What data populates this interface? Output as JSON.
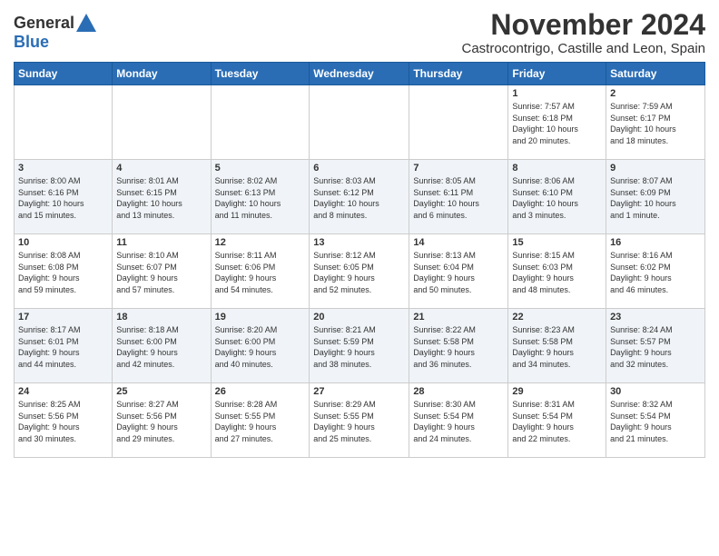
{
  "header": {
    "logo_general": "General",
    "logo_blue": "Blue",
    "month_title": "November 2024",
    "location": "Castrocontrigo, Castille and Leon, Spain"
  },
  "weekdays": [
    "Sunday",
    "Monday",
    "Tuesday",
    "Wednesday",
    "Thursday",
    "Friday",
    "Saturday"
  ],
  "weeks": [
    [
      {
        "day": "",
        "info": ""
      },
      {
        "day": "",
        "info": ""
      },
      {
        "day": "",
        "info": ""
      },
      {
        "day": "",
        "info": ""
      },
      {
        "day": "",
        "info": ""
      },
      {
        "day": "1",
        "info": "Sunrise: 7:57 AM\nSunset: 6:18 PM\nDaylight: 10 hours\nand 20 minutes."
      },
      {
        "day": "2",
        "info": "Sunrise: 7:59 AM\nSunset: 6:17 PM\nDaylight: 10 hours\nand 18 minutes."
      }
    ],
    [
      {
        "day": "3",
        "info": "Sunrise: 8:00 AM\nSunset: 6:16 PM\nDaylight: 10 hours\nand 15 minutes."
      },
      {
        "day": "4",
        "info": "Sunrise: 8:01 AM\nSunset: 6:15 PM\nDaylight: 10 hours\nand 13 minutes."
      },
      {
        "day": "5",
        "info": "Sunrise: 8:02 AM\nSunset: 6:13 PM\nDaylight: 10 hours\nand 11 minutes."
      },
      {
        "day": "6",
        "info": "Sunrise: 8:03 AM\nSunset: 6:12 PM\nDaylight: 10 hours\nand 8 minutes."
      },
      {
        "day": "7",
        "info": "Sunrise: 8:05 AM\nSunset: 6:11 PM\nDaylight: 10 hours\nand 6 minutes."
      },
      {
        "day": "8",
        "info": "Sunrise: 8:06 AM\nSunset: 6:10 PM\nDaylight: 10 hours\nand 3 minutes."
      },
      {
        "day": "9",
        "info": "Sunrise: 8:07 AM\nSunset: 6:09 PM\nDaylight: 10 hours\nand 1 minute."
      }
    ],
    [
      {
        "day": "10",
        "info": "Sunrise: 8:08 AM\nSunset: 6:08 PM\nDaylight: 9 hours\nand 59 minutes."
      },
      {
        "day": "11",
        "info": "Sunrise: 8:10 AM\nSunset: 6:07 PM\nDaylight: 9 hours\nand 57 minutes."
      },
      {
        "day": "12",
        "info": "Sunrise: 8:11 AM\nSunset: 6:06 PM\nDaylight: 9 hours\nand 54 minutes."
      },
      {
        "day": "13",
        "info": "Sunrise: 8:12 AM\nSunset: 6:05 PM\nDaylight: 9 hours\nand 52 minutes."
      },
      {
        "day": "14",
        "info": "Sunrise: 8:13 AM\nSunset: 6:04 PM\nDaylight: 9 hours\nand 50 minutes."
      },
      {
        "day": "15",
        "info": "Sunrise: 8:15 AM\nSunset: 6:03 PM\nDaylight: 9 hours\nand 48 minutes."
      },
      {
        "day": "16",
        "info": "Sunrise: 8:16 AM\nSunset: 6:02 PM\nDaylight: 9 hours\nand 46 minutes."
      }
    ],
    [
      {
        "day": "17",
        "info": "Sunrise: 8:17 AM\nSunset: 6:01 PM\nDaylight: 9 hours\nand 44 minutes."
      },
      {
        "day": "18",
        "info": "Sunrise: 8:18 AM\nSunset: 6:00 PM\nDaylight: 9 hours\nand 42 minutes."
      },
      {
        "day": "19",
        "info": "Sunrise: 8:20 AM\nSunset: 6:00 PM\nDaylight: 9 hours\nand 40 minutes."
      },
      {
        "day": "20",
        "info": "Sunrise: 8:21 AM\nSunset: 5:59 PM\nDaylight: 9 hours\nand 38 minutes."
      },
      {
        "day": "21",
        "info": "Sunrise: 8:22 AM\nSunset: 5:58 PM\nDaylight: 9 hours\nand 36 minutes."
      },
      {
        "day": "22",
        "info": "Sunrise: 8:23 AM\nSunset: 5:58 PM\nDaylight: 9 hours\nand 34 minutes."
      },
      {
        "day": "23",
        "info": "Sunrise: 8:24 AM\nSunset: 5:57 PM\nDaylight: 9 hours\nand 32 minutes."
      }
    ],
    [
      {
        "day": "24",
        "info": "Sunrise: 8:25 AM\nSunset: 5:56 PM\nDaylight: 9 hours\nand 30 minutes."
      },
      {
        "day": "25",
        "info": "Sunrise: 8:27 AM\nSunset: 5:56 PM\nDaylight: 9 hours\nand 29 minutes."
      },
      {
        "day": "26",
        "info": "Sunrise: 8:28 AM\nSunset: 5:55 PM\nDaylight: 9 hours\nand 27 minutes."
      },
      {
        "day": "27",
        "info": "Sunrise: 8:29 AM\nSunset: 5:55 PM\nDaylight: 9 hours\nand 25 minutes."
      },
      {
        "day": "28",
        "info": "Sunrise: 8:30 AM\nSunset: 5:54 PM\nDaylight: 9 hours\nand 24 minutes."
      },
      {
        "day": "29",
        "info": "Sunrise: 8:31 AM\nSunset: 5:54 PM\nDaylight: 9 hours\nand 22 minutes."
      },
      {
        "day": "30",
        "info": "Sunrise: 8:32 AM\nSunset: 5:54 PM\nDaylight: 9 hours\nand 21 minutes."
      }
    ]
  ]
}
